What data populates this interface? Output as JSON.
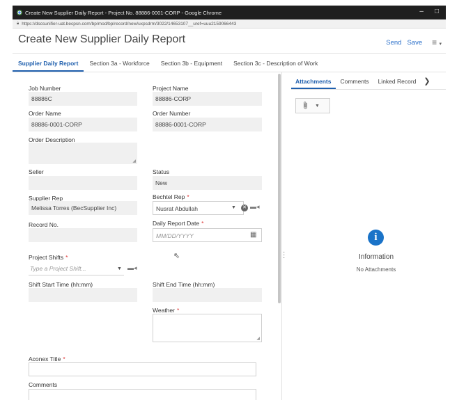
{
  "browser": {
    "title": "Create New Supplier Daily Report - Project No. 88886-0001-CORP - Google Chrome",
    "url": "https://dscsunifier-uat.becpsn.com/bp/mod/bp/record/new/uxpsdrm/3022/14653107__uref=uuu2159066443",
    "minimize": "–",
    "maximize": "□"
  },
  "header": {
    "title": "Create New Supplier Daily Report",
    "send_label": "Send",
    "save_label": "Save",
    "menu_icon": "≡",
    "menu_caret": "▾"
  },
  "tabs": [
    "Supplier Daily Report",
    "Section 3a - Workforce",
    "Section 3b - Equipment",
    "Section 3c - Description of Work"
  ],
  "form": {
    "job_number": {
      "label": "Job Number",
      "value": "88886C"
    },
    "project_name": {
      "label": "Project Name",
      "value": "88886-CORP"
    },
    "order_name": {
      "label": "Order Name",
      "value": "88886-0001-CORP"
    },
    "order_number": {
      "label": "Order Number",
      "value": "88886-0001-CORP"
    },
    "order_description": {
      "label": "Order Description"
    },
    "seller": {
      "label": "Seller"
    },
    "status": {
      "label": "Status",
      "value": "New"
    },
    "supplier_rep": {
      "label": "Supplier Rep",
      "value": "Melissa Torres (BecSupplier Inc)"
    },
    "bechtel_rep": {
      "label": "Bechtel Rep",
      "value": "Nusrat Abdullah"
    },
    "record_no": {
      "label": "Record No."
    },
    "daily_report_date": {
      "label": "Daily Report Date",
      "placeholder": "MM/DD/YYYY"
    },
    "project_shifts": {
      "label": "Project Shifts",
      "placeholder": "Type a Project Shift..."
    },
    "shift_start": {
      "label": "Shift Start Time (hh:mm)"
    },
    "shift_end": {
      "label": "Shift End Time (hh:mm)"
    },
    "weather": {
      "label": "Weather"
    },
    "aconex_title": {
      "label": "Aconex Title"
    },
    "comments": {
      "label": "Comments"
    },
    "required_mark": "*"
  },
  "right_panel": {
    "tabs": [
      "Attachments",
      "Comments",
      "Linked Record"
    ],
    "more": "❯",
    "info_title": "Information",
    "info_sub": "No Attachments"
  },
  "icons": {
    "paperclip": "paperclip-icon",
    "info": "info-icon",
    "calendar": "calendar-icon",
    "clear": "clear-icon",
    "lookup": "lookup-icon"
  },
  "colors": {
    "accent": "#1f5fad",
    "link": "#2a6fc9",
    "info": "#1a73c8",
    "required": "#d33333"
  }
}
